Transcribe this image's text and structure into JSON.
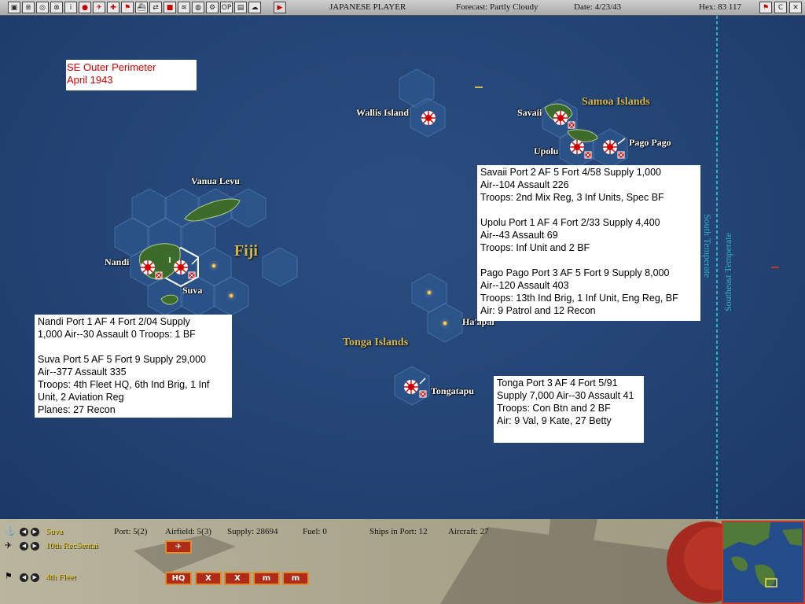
{
  "toolbar": {
    "player": "JAPANESE PLAYER",
    "forecast": "Forecast: Partly Cloudy",
    "date": "Date: 4/23/43",
    "hex": "Hex: 83 117",
    "icons": [
      "save-icon",
      "list-icon",
      "target-icon",
      "group-icon",
      "info-icon",
      "flag-red-icon",
      "plane-icon",
      "plane-alt-icon",
      "flag-icon",
      "ship-icon",
      "swap-icon",
      "map-icon",
      "fleet-icon",
      "globe-icon",
      "gear-icon",
      "op-icon",
      "clipboard-icon",
      "cloud-icon"
    ]
  },
  "map": {
    "title": [
      "SE Outer Perimeter",
      "April 1943"
    ],
    "places": {
      "wallis": "Wallis Island",
      "samoa": "Samoa Islands",
      "savaii": "Savaii",
      "upolu": "Upolu",
      "pagopago": "Pago Pago",
      "vanualevu": "Vanua Levu",
      "fiji": "Fiji",
      "nandi": "Nandi",
      "suva": "Suva",
      "tonga": "Tonga Islands",
      "haapai": "Ha'apai",
      "tongatapu": "Tongatapu"
    },
    "zones": {
      "south_temperate": "South Temperate",
      "southeast_temperate": "Southeast Temperate"
    },
    "notes": {
      "samoa": [
        "Savaii  Port 2  AF 5  Fort 4/58  Supply 1,000",
        "Air--104  Assault 226",
        "Troops:  2nd Mix Reg, 3 Inf Units, Spec BF",
        "",
        "Upolu  Port 1  AF 4  Fort 2/33  Supply 4,400",
        "Air--43  Assault 69",
        "Troops:  Inf Unit and 2 BF",
        "",
        "Pago Pago  Port 3  AF 5  Fort 9  Supply 8,000",
        "Air--120  Assault 403",
        "Troops:  13th Ind Brig, 1 Inf Unit, Eng Reg, BF",
        "Air:  9 Patrol and 12 Recon"
      ],
      "fiji": [
        "Nandi  Port 1  AF 4  Fort 2/04  Supply",
        "1,000  Air--30  Assault 0  Troops: 1 BF",
        "",
        "Suva  Port 5  AF 5  Fort 9  Supply 29,000",
        "Air--377  Assault 335",
        "Troops:  4th Fleet HQ, 6th Ind Brig, 1 Inf",
        "Unit, 2 Aviation Reg",
        "Planes:  27 Recon"
      ],
      "tonga": [
        "Tonga  Port 3  AF 4  Fort 5/91",
        "Supply 7,000  Air--30 Assault 41",
        "Troops:  Con Btn and 2 BF",
        "Air:  9 Val, 9 Kate, 27 Betty"
      ]
    }
  },
  "bottom": {
    "base_name": "Suva",
    "port": "Port: 5(2)",
    "airfield": "Airfield: 5(3)",
    "supply": "Supply: 28694",
    "fuel": "Fuel: 0",
    "ships": "Ships in Port: 12",
    "aircraft": "Aircraft: 27",
    "air_unit": "10th RecSentai",
    "hq": "4th Fleet",
    "unit_buttons": [
      "HQ",
      "X",
      "X",
      "m",
      "m"
    ]
  },
  "colors": {
    "japanese_flag": "#d10000",
    "ocean": "#234475",
    "label_gold": "#d6b64a",
    "panel": "#b3ad95"
  }
}
